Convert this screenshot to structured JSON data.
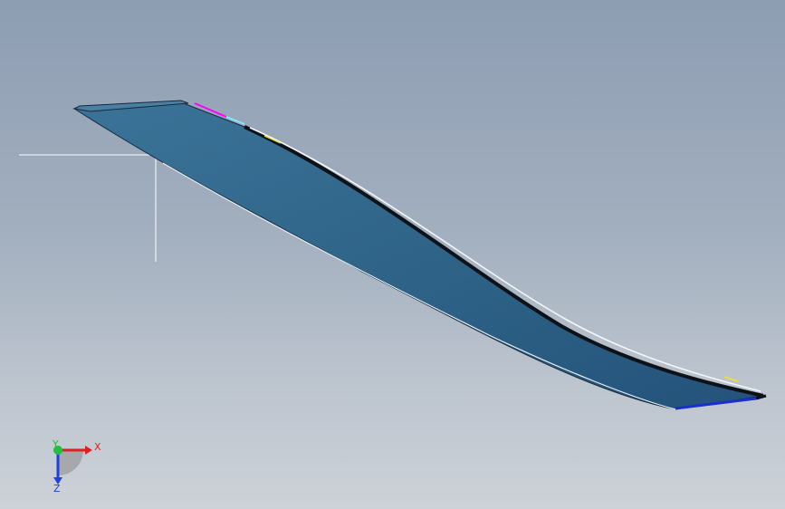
{
  "viewport": {
    "background_top": "#8d9db2",
    "background_bottom": "#cdd2d8"
  },
  "model": {
    "surface_color": "#2f6488",
    "edge_color": "#101820",
    "highlight_colors": [
      "#ff00ff",
      "#ffff00",
      "#00ffff",
      "#1a2fd0"
    ]
  },
  "triad": {
    "x_label": "X",
    "y_label": "Y",
    "z_label": "Z",
    "x_color": "#e02020",
    "y_color": "#20c040",
    "z_color": "#2040e0"
  }
}
